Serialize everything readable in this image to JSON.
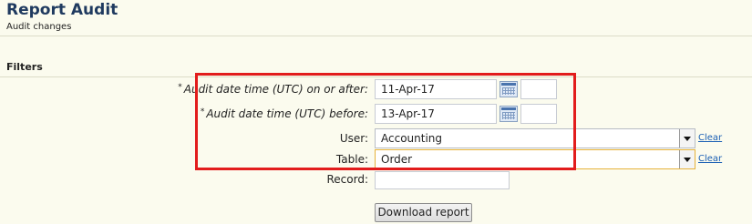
{
  "header": {
    "title": "Report Audit",
    "subtitle": "Audit changes"
  },
  "filters": {
    "heading": "Filters",
    "required_marker": "*",
    "date_from": {
      "label": "Audit date time (UTC) on or after:",
      "value": "11-Apr-17",
      "time_value": ""
    },
    "date_to": {
      "label": "Audit date time (UTC) before:",
      "value": "13-Apr-17",
      "time_value": ""
    },
    "user": {
      "label": "User:",
      "value": "Accounting",
      "clear_label": "Clear"
    },
    "table": {
      "label": "Table:",
      "value": "Order",
      "clear_label": "Clear"
    },
    "record": {
      "label": "Record:",
      "value": ""
    }
  },
  "actions": {
    "download_label": "Download report"
  },
  "icons": {
    "calendar": "calendar-icon",
    "dropdown": "chevron-down-icon"
  },
  "colors": {
    "accent": "#1f3a5f",
    "highlight": "#e21c1c",
    "link": "#1a5fb4",
    "background": "#fbfbee"
  }
}
